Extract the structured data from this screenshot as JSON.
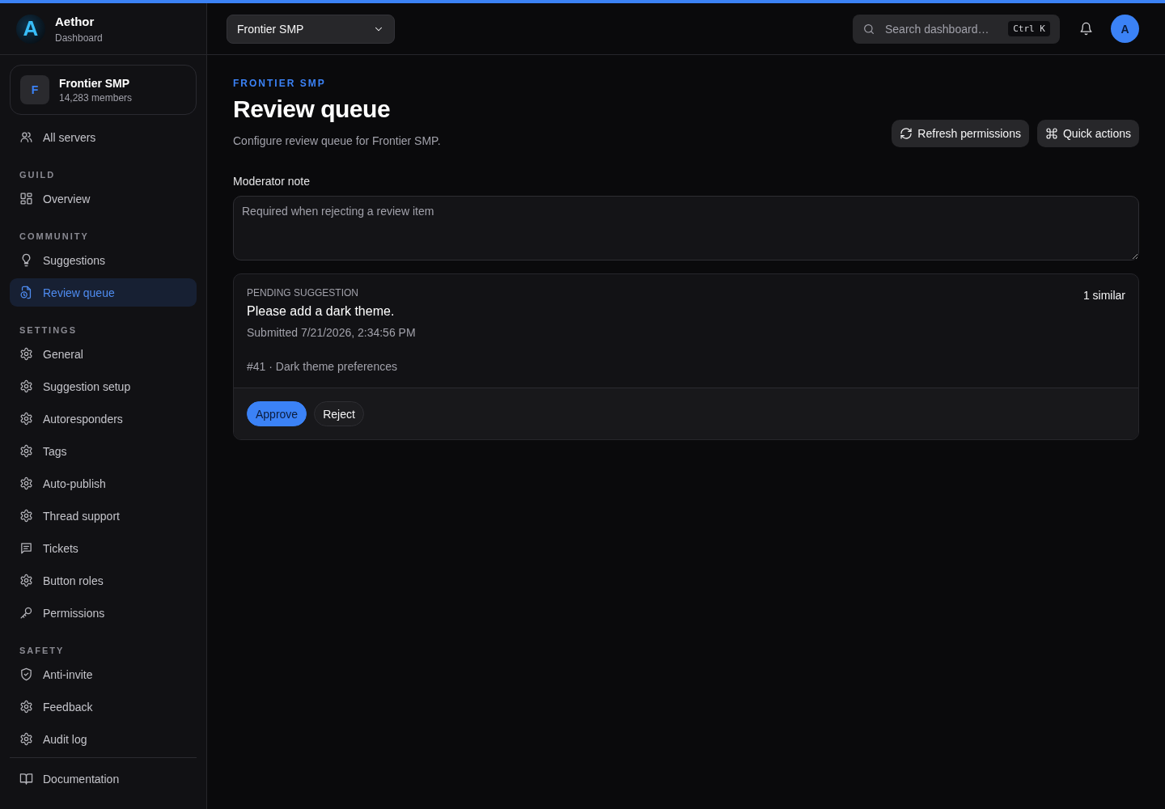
{
  "brand": {
    "logo": "A",
    "name": "Aethor",
    "subtitle": "Dashboard"
  },
  "server_card": {
    "initial": "F",
    "name": "Frontier SMP",
    "members": "14,283 members"
  },
  "sidebar": {
    "sections": [
      {
        "items": [
          {
            "label": "All servers",
            "kind": "users",
            "selected": false
          }
        ]
      },
      {
        "heading": "GUILD",
        "items": [
          {
            "label": "Overview",
            "kind": "grid",
            "selected": false
          }
        ]
      },
      {
        "heading": "COMMUNITY",
        "items": [
          {
            "label": "Suggestions",
            "kind": "bulb",
            "selected": false
          },
          {
            "label": "Review queue",
            "kind": "file",
            "selected": true
          }
        ]
      },
      {
        "heading": "SETTINGS",
        "items": [
          {
            "label": "General",
            "kind": "gear",
            "selected": false
          },
          {
            "label": "Suggestion setup",
            "kind": "gear",
            "selected": false
          },
          {
            "label": "Autoresponders",
            "kind": "gear",
            "selected": false
          },
          {
            "label": "Tags",
            "kind": "gear",
            "selected": false
          },
          {
            "label": "Auto-publish",
            "kind": "gear",
            "selected": false
          },
          {
            "label": "Thread support",
            "kind": "gear",
            "selected": false
          },
          {
            "label": "Tickets",
            "kind": "chat",
            "selected": false
          },
          {
            "label": "Button roles",
            "kind": "gear",
            "selected": false
          },
          {
            "label": "Permissions",
            "kind": "key",
            "selected": false
          }
        ]
      },
      {
        "heading": "SAFETY",
        "items": [
          {
            "label": "Anti-invite",
            "kind": "shield",
            "selected": false
          },
          {
            "label": "Feedback",
            "kind": "gear",
            "selected": false
          },
          {
            "label": "Audit log",
            "kind": "gear",
            "selected": false
          }
        ]
      }
    ],
    "footer_items": [
      {
        "label": "Documentation",
        "kind": "book",
        "selected": false
      }
    ]
  },
  "topbar": {
    "server_select": "Frontier SMP",
    "search": {
      "placeholder": "Search dashboard…",
      "shortcut": "Ctrl K"
    },
    "avatar": "A"
  },
  "page": {
    "eyebrow": "FRONTIER SMP",
    "title": "Review queue",
    "description": "Configure review queue for Frontier SMP.",
    "actions": [
      {
        "label": "Refresh permissions",
        "kind": "refresh"
      },
      {
        "label": "Quick actions",
        "kind": "command"
      }
    ]
  },
  "note": {
    "label": "Moderator note",
    "placeholder": "Required when rejecting a review item"
  },
  "review_item": {
    "tag": "PENDING SUGGESTION",
    "title": "Please add a dark theme.",
    "submitted": "Submitted 7/21/2026, 2:34:56 PM",
    "similar": "1 similar",
    "meta": "#41 · Dark theme preferences",
    "buttons": [
      {
        "label": "Approve",
        "kind": "primary"
      },
      {
        "label": "Reject",
        "kind": "secondary"
      }
    ]
  }
}
